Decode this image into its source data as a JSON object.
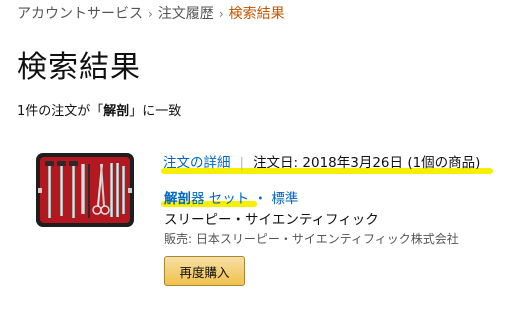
{
  "breadcrumb": {
    "items": [
      "アカウントサービス",
      "注文履歴"
    ],
    "current": "検索結果",
    "separator": "›"
  },
  "page": {
    "title": "検索結果"
  },
  "summary": {
    "prefix": "1件の注文が「",
    "query": "解剖",
    "suffix": "」に一致"
  },
  "order": {
    "details_label": "注文の詳細",
    "date_text": "注文日: 2018年3月26日 (1個の商品)",
    "product": {
      "title_highlight": "解剖",
      "title_rest": "器 セット ・ 標準",
      "brand": "スリーピー・サイエンティフィック",
      "seller": "販売: 日本スリーピー・サイエンティフィック株式会社",
      "image_icon": "dissection-kit-image"
    },
    "rebuy_label": "再度購入"
  },
  "colors": {
    "link": "#0066c0",
    "breadcrumb_current": "#c45500",
    "highlight": "#f6f000",
    "button": "#f0c14b"
  }
}
